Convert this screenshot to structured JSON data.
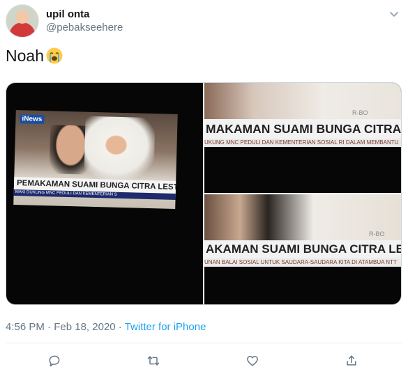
{
  "author": {
    "display_name": "upil onta",
    "handle": "@pebakseehere"
  },
  "tweet": {
    "text": "Noah",
    "emoji": "loudly-crying-face"
  },
  "media": {
    "news_logo": "iNews",
    "headline_full": "PEMAKAMAN SUAMI BUNGA CITRA LESTARI",
    "ticker_full": "MAKI DUKUNG MNC PEDULI DAN KEMENTERIAN S",
    "zoom_top_headline": "MAKAMAN SUAMI BUNGA CITRA LESTARI",
    "zoom_top_ticker": "UKUNG MNC PEDULI DAN KEMENTERIAN SOSIAL RI DALAM MEMBANTU",
    "zoom_bot_headline": "AKAMAN SUAMI BUNGA CITRA LESTARI",
    "zoom_bot_ticker": "UNAN BALAI SOSIAL UNTUK SAUDARA-SAUDARA KITA DI ATAMBUA NTT",
    "watermark": "R-BO"
  },
  "meta": {
    "time": "4:56 PM",
    "sep1": "·",
    "date": "Feb 18, 2020",
    "sep2": "·",
    "source": "Twitter for iPhone"
  },
  "colors": {
    "link": "#1da1f2",
    "secondary": "#657786",
    "divider": "#e6ecf0"
  },
  "actions": {
    "reply": "reply-icon",
    "retweet": "retweet-icon",
    "like": "heart-icon",
    "share": "share-icon"
  }
}
